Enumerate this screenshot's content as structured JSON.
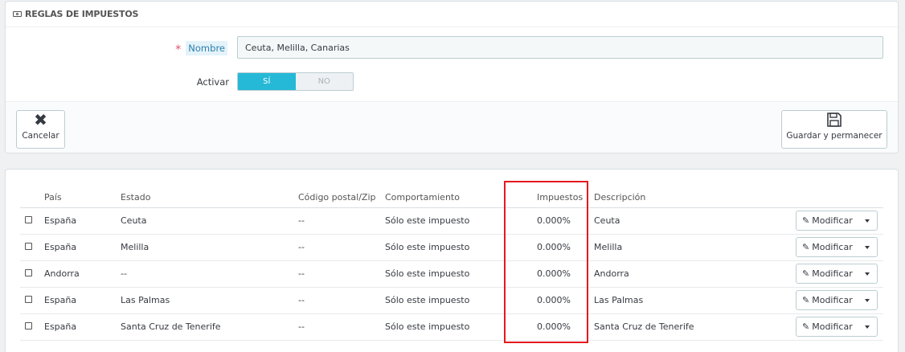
{
  "panel": {
    "title": "REGLAS DE IMPUESTOS",
    "title_icon": "money-icon"
  },
  "form": {
    "name_required_mark": "*",
    "name_label": "Nombre",
    "name_value": "Ceuta, Melilla, Canarias",
    "active_label": "Activar",
    "toggle_yes": "SÍ",
    "toggle_no": "NO",
    "toggle_selected": "SÍ"
  },
  "footer": {
    "cancel_label": "Cancelar",
    "cancel_icon": "close-icon",
    "save_label": "Guardar y permanecer",
    "save_icon": "save-icon"
  },
  "table": {
    "columns": {
      "country": "País",
      "state": "Estado",
      "zip": "Código postal/Zip",
      "behavior": "Comportamiento",
      "tax": "Impuestos",
      "description": "Descripción"
    },
    "rows": [
      {
        "country": "España",
        "state": "Ceuta",
        "zip": "--",
        "behavior": "Sólo este impuesto",
        "tax": "0.000%",
        "description": "Ceuta",
        "action": "Modificar"
      },
      {
        "country": "España",
        "state": "Melilla",
        "zip": "--",
        "behavior": "Sólo este impuesto",
        "tax": "0.000%",
        "description": "Melilla",
        "action": "Modificar"
      },
      {
        "country": "Andorra",
        "state": "--",
        "zip": "--",
        "behavior": "Sólo este impuesto",
        "tax": "0.000%",
        "description": "Andorra",
        "action": "Modificar"
      },
      {
        "country": "España",
        "state": "Las Palmas",
        "zip": "--",
        "behavior": "Sólo este impuesto",
        "tax": "0.000%",
        "description": "Las Palmas",
        "action": "Modificar"
      },
      {
        "country": "España",
        "state": "Santa Cruz de Tenerife",
        "zip": "--",
        "behavior": "Sólo este impuesto",
        "tax": "0.000%",
        "description": "Santa Cruz de Tenerife",
        "action": "Modificar"
      }
    ]
  },
  "colors": {
    "accent": "#25b9d7",
    "highlight": "#e5191f",
    "required": "#e84e6a"
  }
}
